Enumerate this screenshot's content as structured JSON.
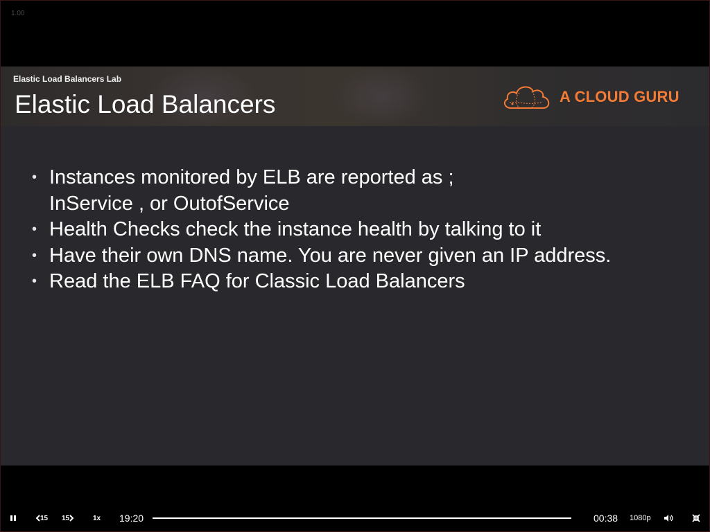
{
  "player": {
    "version_label": "1.00",
    "speed_label": "1x",
    "rewind_label": "15",
    "forward_label": "15",
    "elapsed_time": "19:20",
    "remaining_time": "00:38",
    "quality_label": "1080p",
    "progress_fraction": 1.0
  },
  "slide": {
    "subtitle": "Elastic Load Balancers Lab",
    "title": "Elastic Load Balancers",
    "logo_text": "A CLOUD GURU",
    "brand_color": "#f47b35",
    "bullets": [
      {
        "line1": "Instances monitored by ELB are reported as ;",
        "line2": "InService , or OutofService"
      },
      {
        "line1": "Health Checks check the instance health by talking to it"
      },
      {
        "line1": "Have their own DNS name. You are never given an IP address."
      },
      {
        "line1": "Read the ELB FAQ for Classic Load Balancers"
      }
    ]
  },
  "icons": {
    "pause": "pause-icon",
    "rewind": "rewind-15-icon",
    "forward": "forward-15-icon",
    "volume": "volume-icon",
    "fullscreen": "exit-fullscreen-icon",
    "logo": "cloud-logo-icon"
  }
}
